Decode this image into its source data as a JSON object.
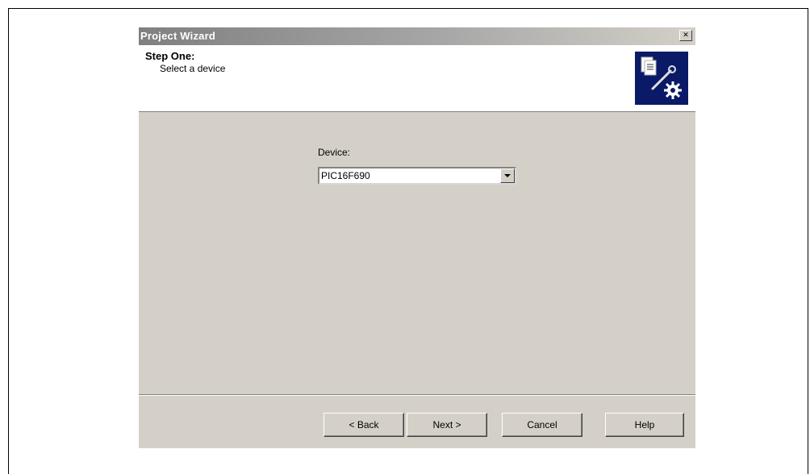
{
  "window": {
    "title": "Project Wizard",
    "close_glyph": "✕"
  },
  "header": {
    "step_title": "Step One:",
    "step_subtitle": "Select a device",
    "icon": "wizard-tools-icon"
  },
  "form": {
    "device_label": "Device:",
    "device_value": "PIC16F690"
  },
  "buttons": {
    "back": "< Back",
    "next": "Next >",
    "cancel": "Cancel",
    "help": "Help"
  },
  "colors": {
    "dialog_bg": "#d4d0c8",
    "icon_bg": "#0a1a66",
    "header_bg": "#ffffff"
  }
}
